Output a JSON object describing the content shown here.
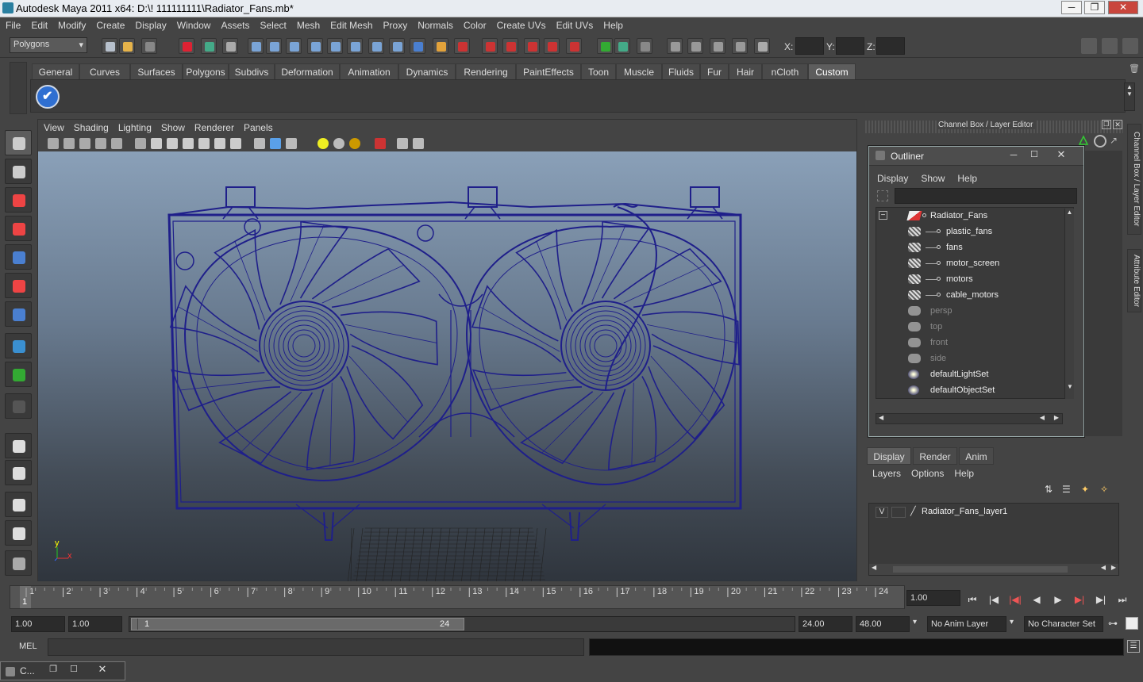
{
  "window": {
    "title": "Autodesk Maya 2011 x64: D:\\! 111111111\\Radiator_Fans.mb*",
    "min_glyph": "─",
    "max_glyph": "❐",
    "close_glyph": "✕"
  },
  "menubar": [
    "File",
    "Edit",
    "Modify",
    "Create",
    "Display",
    "Window",
    "Assets",
    "Select",
    "Mesh",
    "Edit Mesh",
    "Proxy",
    "Normals",
    "Color",
    "Create UVs",
    "Edit UVs",
    "Help"
  ],
  "statusline": {
    "mode_dropdown": "Polygons",
    "x_label": "X:",
    "y_label": "Y:",
    "z_label": "Z:"
  },
  "shelf": {
    "tabs": [
      "General",
      "Curves",
      "Surfaces",
      "Polygons",
      "Subdivs",
      "Deformation",
      "Animation",
      "Dynamics",
      "Rendering",
      "PaintEffects",
      "Toon",
      "Muscle",
      "Fluids",
      "Fur",
      "Hair",
      "nCloth",
      "Custom"
    ],
    "active_tab": "Custom"
  },
  "viewport": {
    "menu": [
      "View",
      "Shading",
      "Lighting",
      "Show",
      "Renderer",
      "Panels"
    ],
    "axis_y": "y",
    "axis_x": "x",
    "wire_color": "#1f1f8a"
  },
  "channel_box": {
    "header": "Channel Box / Layer Editor"
  },
  "outliner": {
    "title": "Outliner",
    "menu": [
      "Display",
      "Show",
      "Help"
    ],
    "collapse_glyph": "−",
    "items": [
      {
        "label": "Radiator_Fans",
        "type": "transform",
        "dim": false
      },
      {
        "label": "plastic_fans",
        "type": "mesh",
        "dim": false
      },
      {
        "label": "fans",
        "type": "mesh",
        "dim": false
      },
      {
        "label": "motor_screen",
        "type": "mesh",
        "dim": false
      },
      {
        "label": "motors",
        "type": "mesh",
        "dim": false
      },
      {
        "label": "cable_motors",
        "type": "mesh",
        "dim": false
      },
      {
        "label": "persp",
        "type": "camera",
        "dim": true
      },
      {
        "label": "top",
        "type": "camera",
        "dim": true
      },
      {
        "label": "front",
        "type": "camera",
        "dim": true
      },
      {
        "label": "side",
        "type": "camera",
        "dim": true
      },
      {
        "label": "defaultLightSet",
        "type": "set",
        "dim": false
      },
      {
        "label": "defaultObjectSet",
        "type": "set",
        "dim": false
      }
    ]
  },
  "side_tabs": [
    "Channel Box / Layer Editor",
    "Attribute Editor"
  ],
  "layer_editor": {
    "tabs": [
      "Display",
      "Render",
      "Anim"
    ],
    "active_tab": "Display",
    "menu": [
      "Layers",
      "Options",
      "Help"
    ],
    "layers": [
      {
        "visible": "V",
        "name": "Radiator_Fans_layer1"
      }
    ]
  },
  "time_slider": {
    "ticks": [
      "1",
      "2",
      "3",
      "4",
      "5",
      "6",
      "7",
      "8",
      "9",
      "10",
      "11",
      "12",
      "13",
      "14",
      "15",
      "16",
      "17",
      "18",
      "19",
      "20",
      "21",
      "22",
      "23",
      "24"
    ],
    "current_frame_marker": "1",
    "current_time": "1.00",
    "playback_glyphs": [
      "⏮",
      "|◀",
      "|◀|",
      "◀",
      "▶",
      "▶|",
      "▶|",
      "⏭"
    ]
  },
  "range_slider": {
    "start_time": "1.00",
    "playback_start": "1.00",
    "range_start_label": "1",
    "range_end_label": "24",
    "playback_end": "24.00",
    "end_time": "48.00",
    "anim_layer": "No Anim Layer",
    "character_set": "No Character Set"
  },
  "command_line": {
    "label": "MEL"
  },
  "taskbar": {
    "item": "C..."
  }
}
